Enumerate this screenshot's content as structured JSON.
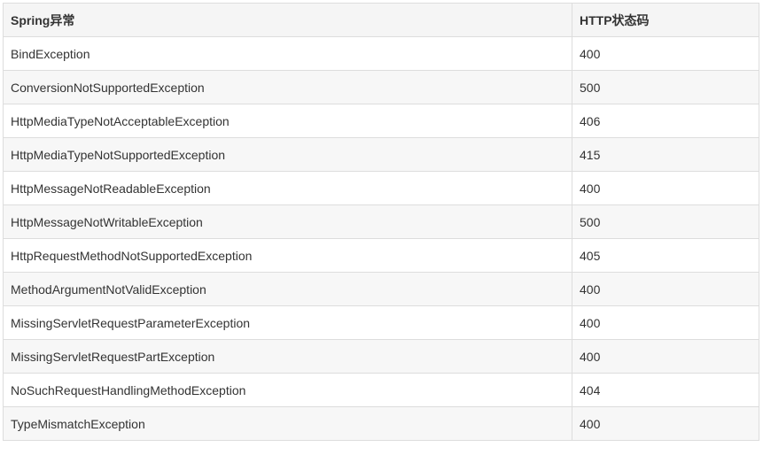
{
  "table": {
    "headers": [
      "Spring异常",
      "HTTP状态码"
    ],
    "rows": [
      [
        "BindException",
        "400"
      ],
      [
        "ConversionNotSupportedException",
        "500"
      ],
      [
        "HttpMediaTypeNotAcceptableException",
        "406"
      ],
      [
        "HttpMediaTypeNotSupportedException",
        "415"
      ],
      [
        "HttpMessageNotReadableException",
        "400"
      ],
      [
        "HttpMessageNotWritableException",
        "500"
      ],
      [
        "HttpRequestMethodNotSupportedException",
        "405"
      ],
      [
        "MethodArgumentNotValidException",
        "400"
      ],
      [
        "MissingServletRequestParameterException",
        "400"
      ],
      [
        "MissingServletRequestPartException",
        "400"
      ],
      [
        "NoSuchRequestHandlingMethodException",
        "404"
      ],
      [
        "TypeMismatchException",
        "400"
      ]
    ]
  },
  "colors": {
    "header_bg": "#f5f5f5",
    "row_alt_bg": "#f7f7f7",
    "border": "#dddddd",
    "text": "#333333"
  }
}
